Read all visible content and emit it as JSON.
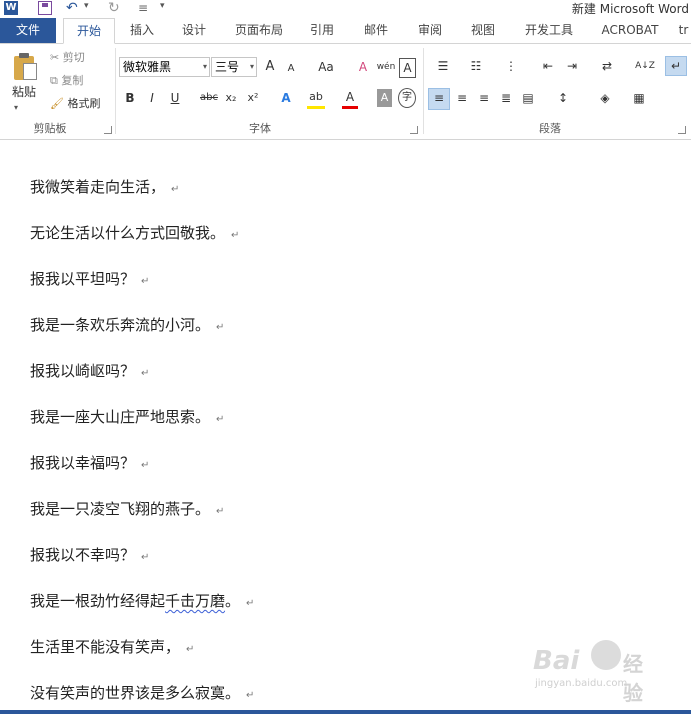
{
  "window": {
    "title": "新建 Microsoft Word"
  },
  "qat": {
    "logo": "W",
    "undo": "↶",
    "redo": "↻",
    "customize": "≡",
    "dropdown": "▾"
  },
  "tabs": [
    {
      "label": "文件"
    },
    {
      "label": "开始"
    },
    {
      "label": "插入"
    },
    {
      "label": "设计"
    },
    {
      "label": "页面布局"
    },
    {
      "label": "引用"
    },
    {
      "label": "邮件"
    },
    {
      "label": "审阅"
    },
    {
      "label": "视图"
    },
    {
      "label": "开发工具"
    },
    {
      "label": "ACROBAT"
    },
    {
      "label": "tr"
    }
  ],
  "clipboard": {
    "paste_label": "粘贴",
    "cut_label": "剪切",
    "copy_label": "复制",
    "format_painter_label": "格式刷",
    "group_label": "剪贴板"
  },
  "font": {
    "name": "微软雅黑",
    "size": "三号",
    "group_label": "字体",
    "grow": "A",
    "shrink": "A",
    "case": "Aa",
    "clear": "A",
    "pinyin": "wén",
    "border_char": "A",
    "bold": "B",
    "italic": "I",
    "underline": "U",
    "strike": "abc",
    "sub": "x₂",
    "sup": "x²",
    "effects": "A",
    "highlight": "ab",
    "color": "A",
    "shading": "A",
    "enclose": "字"
  },
  "paragraph": {
    "group_label": "段落",
    "sort_icon": "A↓Z",
    "show_marks": "↵"
  },
  "colors": {
    "accent": "#2b579a",
    "highlight": "#ffe600",
    "font_color": "#e60000"
  },
  "document": {
    "paragraph_mark": "↵",
    "lines": [
      "我微笑着走向生活，",
      "无论生活以什么方式回敬我。",
      "报我以平坦吗？",
      "我是一条欢乐奔流的小河。",
      "报我以崎岖吗？",
      "我是一座大山庄严地思索。",
      "报我以幸福吗？",
      "我是一只凌空飞翔的燕子。",
      "报我以不幸吗？",
      "我是一根劲竹经得起",
      "生活里不能没有笑声，",
      "没有笑声的世界该是多么寂寞。"
    ],
    "line10_squiggle": "千击万磨",
    "line10_end": "。"
  },
  "watermark": {
    "brand": "Bai",
    "brand2": "经验",
    "url": "jingyan.baidu.com"
  }
}
